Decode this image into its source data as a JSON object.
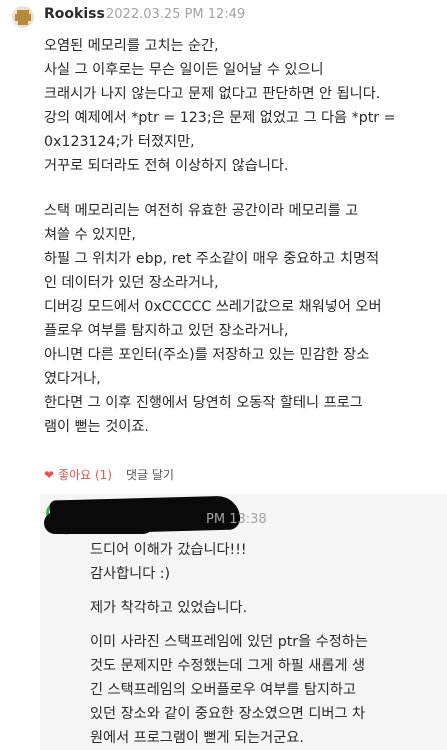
{
  "comment": {
    "author": "Rookiss",
    "timestamp": "2022.03.25 PM 12:49",
    "para1": [
      "오염된 메모리를 고치는 순간,",
      "사실 그 이후로는 무슨 일이든 일어날 수 있으니",
      "크래시가 나지 않는다고 문제 없다고 판단하면 안 됩니다.",
      "강의 예제에서 *ptr = 123;은 문제 없었고 그 다음 *ptr =",
      "0x123124;가 터졌지만,",
      "거꾸로 되더라도 전혀 이상하지 않습니다."
    ],
    "para2": [
      "스택 메모리리는 여전히 유효한 공간이라 메모리를 고",
      "쳐쓸 수 있지만,",
      "하필 그 위치가 ebp, ret 주소같이 매우 중요하고 치명적",
      "인 데이터가 있던 장소라거나,",
      "디버깅 모드에서 0xCCCCC 쓰레기값으로 채워넣어 오버",
      "플로우 여부를 탐지하고 있던 장소라거나,",
      "아니면 다른 포인터(주소)를 저장하고 있는 민감한 장소",
      "였다거나,",
      "한다면 그 이후 진행에서 당연히 오동작 할테니 프로그",
      "램이 뻗는 것이죠."
    ],
    "like_label": "좋아요 (1)",
    "reply_label": "댓글 달기"
  },
  "reply": {
    "timestamp": "PM 13:38",
    "para1": [
      "드디어 이해가 갔습니다!!!",
      "감사합니다 :)"
    ],
    "para2": [
      "제가 착각하고 있었습니다."
    ],
    "para3": [
      "이미 사라진 스택프레임에 있던 ptr을 수정하는",
      "것도 문제지만 수정했는데 그게 하필 새롭게 생",
      "긴 스택프레임의 오버플로우 여부를 탐지하고",
      "있던 장소와 같이 중요한 장소였으면 디버그 차",
      "원에서 프로그램이 뻗게 되는거군요."
    ]
  },
  "colors": {
    "like": "#e05454",
    "timestamp": "#a3a3a3",
    "reply_bg": "#f5f5f5",
    "avatar_ring": "#3cb45a"
  }
}
